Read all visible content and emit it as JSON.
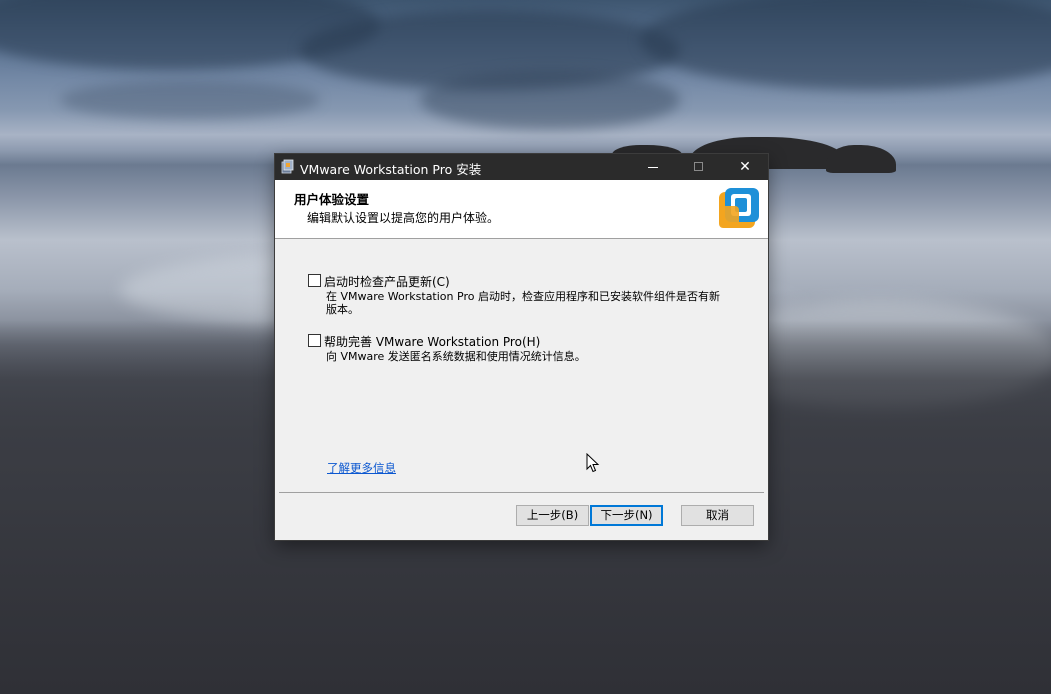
{
  "window": {
    "title": "VMware Workstation Pro 安装",
    "controls": {
      "minimize": "minimize-icon",
      "maximize": "maximize-icon",
      "close": "✕"
    }
  },
  "header": {
    "title": "用户体验设置",
    "subtitle": "编辑默认设置以提高您的用户体验。",
    "logo_icon": "vmware-logo-icon"
  },
  "options": [
    {
      "label": "启动时检查产品更新(C)",
      "checked": false,
      "description": "在 VMware Workstation Pro 启动时，检查应用程序和已安装软件组件是否有新版本。"
    },
    {
      "label": "帮助完善 VMware Workstation Pro(H)",
      "checked": false,
      "description": "向 VMware 发送匿名系统数据和使用情况统计信息。"
    }
  ],
  "link": {
    "label": "了解更多信息"
  },
  "buttons": {
    "back": "上一步(B)",
    "next": "下一步(N)",
    "cancel": "取消"
  },
  "colors": {
    "titlebar": "#2b2b2b",
    "dialog_bg": "#f0f0f0",
    "link": "#0b57d0",
    "default_button_border": "#0078d7"
  }
}
